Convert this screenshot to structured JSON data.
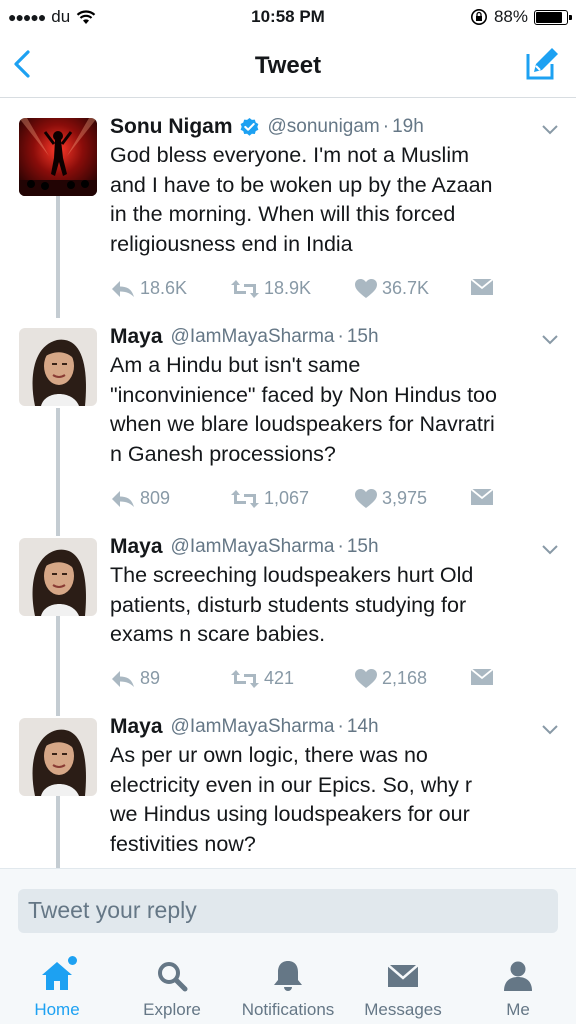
{
  "status_bar": {
    "signal_dots": "●●●●●",
    "carrier": "du",
    "time": "10:58 PM",
    "battery": "88%",
    "battery_level": 0.88
  },
  "nav": {
    "title": "Tweet"
  },
  "tweets": [
    {
      "name": "Sonu Nigam",
      "verified": true,
      "handle": "@sonunigam",
      "separator": "·",
      "time": "19h",
      "text_lines": [
        "God bless everyone. I'm not a Muslim",
        "and I have to be woken up by the Azaan",
        "in the morning. When will this forced",
        "religiousness end in India"
      ],
      "replies": "18.6K",
      "retweets": "18.9K",
      "likes": "36.7K"
    },
    {
      "name": "Maya",
      "verified": false,
      "handle": "@IamMayaSharma",
      "separator": "·",
      "time": "15h",
      "text_lines": [
        "Am a Hindu but isn't same",
        "\"inconvinience\" faced by Non Hindus too",
        "when we blare loudspeakers for Navratri",
        "n Ganesh processions?"
      ],
      "replies": "809",
      "retweets": "1,067",
      "likes": "3,975"
    },
    {
      "name": "Maya",
      "verified": false,
      "handle": "@IamMayaSharma",
      "separator": "·",
      "time": "15h",
      "text_lines": [
        "The screeching loudspeakers hurt Old",
        "patients, disturb students studying for",
        "exams n scare babies."
      ],
      "replies": "89",
      "retweets": "421",
      "likes": "2,168"
    },
    {
      "name": "Maya",
      "verified": false,
      "handle": "@IamMayaSharma",
      "separator": "·",
      "time": "14h",
      "text_lines": [
        "As per ur own logic, there was no",
        "electricity even in our Epics. So, why r",
        "we Hindus using loudspeakers for our",
        "festivities now?"
      ]
    }
  ],
  "reply": {
    "placeholder": "Tweet your reply"
  },
  "tabs": [
    {
      "label": "Home",
      "icon": "home-icon",
      "active": true
    },
    {
      "label": "Explore",
      "icon": "search-icon",
      "active": false
    },
    {
      "label": "Notifications",
      "icon": "bell-icon",
      "active": false
    },
    {
      "label": "Messages",
      "icon": "envelope-icon",
      "active": false
    },
    {
      "label": "Me",
      "icon": "person-icon",
      "active": false
    }
  ],
  "colors": {
    "accent": "#1da1f2",
    "muted": "#8899a6",
    "thread_line": "#c4ccd2"
  }
}
